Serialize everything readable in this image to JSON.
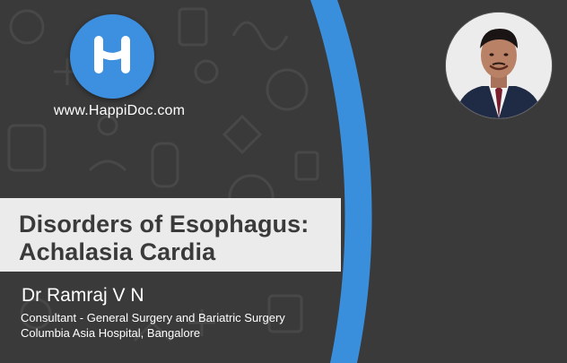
{
  "brand": {
    "website": "www.HappiDoc.com",
    "accent_color": "#3d8fe0",
    "logo_icon": "happidoc-h-logo-icon"
  },
  "slide": {
    "title_line_1": "Disorders of Esophagus:",
    "title_line_2": "Achalasia Cardia"
  },
  "speaker": {
    "name": "Dr Ramraj V N",
    "role": "Consultant - General Surgery and Bariatric Surgery",
    "organization": "Columbia Asia Hospital, Bangalore",
    "photo_icon": "speaker-portrait-icon"
  },
  "colors": {
    "background": "#3a3a3a",
    "title_band": "#ebebeb",
    "title_text": "#3a3a3a",
    "swoosh_blue": "#3a8fdc",
    "swoosh_grey": "#c7c7c7"
  }
}
